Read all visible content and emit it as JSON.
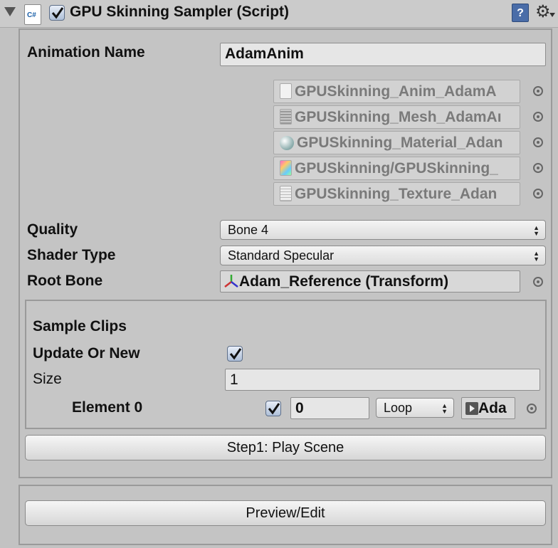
{
  "header": {
    "title": "GPU Skinning Sampler (Script)",
    "script_icon_text": "C#",
    "enabled": true,
    "help_icon_text": "?"
  },
  "fields": {
    "animation_name_label": "Animation Name",
    "animation_name_value": "AdamAnim",
    "assets": [
      {
        "name": "GPUSkinning_Anim_AdamA",
        "icon": "file-icon"
      },
      {
        "name": "GPUSkinning_Mesh_AdamAı",
        "icon": "mesh-icon"
      },
      {
        "name": "GPUSkinning_Material_Adan",
        "icon": "material-icon"
      },
      {
        "name": "GPUSkinning/GPUSkinning_",
        "icon": "shader-icon"
      },
      {
        "name": "GPUSkinning_Texture_Adan",
        "icon": "texture-icon"
      }
    ],
    "quality_label": "Quality",
    "quality_value": "Bone 4",
    "shader_type_label": "Shader Type",
    "shader_type_value": "Standard Specular",
    "root_bone_label": "Root Bone",
    "root_bone_value": "Adam_Reference (Transform)"
  },
  "sample_clips": {
    "heading": "Sample Clips",
    "update_or_new_label": "Update Or New",
    "update_or_new_checked": true,
    "size_label": "Size",
    "size_value": "1",
    "element_label": "Element 0",
    "element_checked": true,
    "element_frame": "0",
    "element_mode": "Loop",
    "element_clip": "Ada"
  },
  "buttons": {
    "play_scene": "Step1: Play Scene",
    "preview_edit": "Preview/Edit"
  },
  "colors": {
    "background": "#c2c2c2",
    "checkbox_accent": "#5d6e88",
    "help_icon": "#4a6da8"
  }
}
